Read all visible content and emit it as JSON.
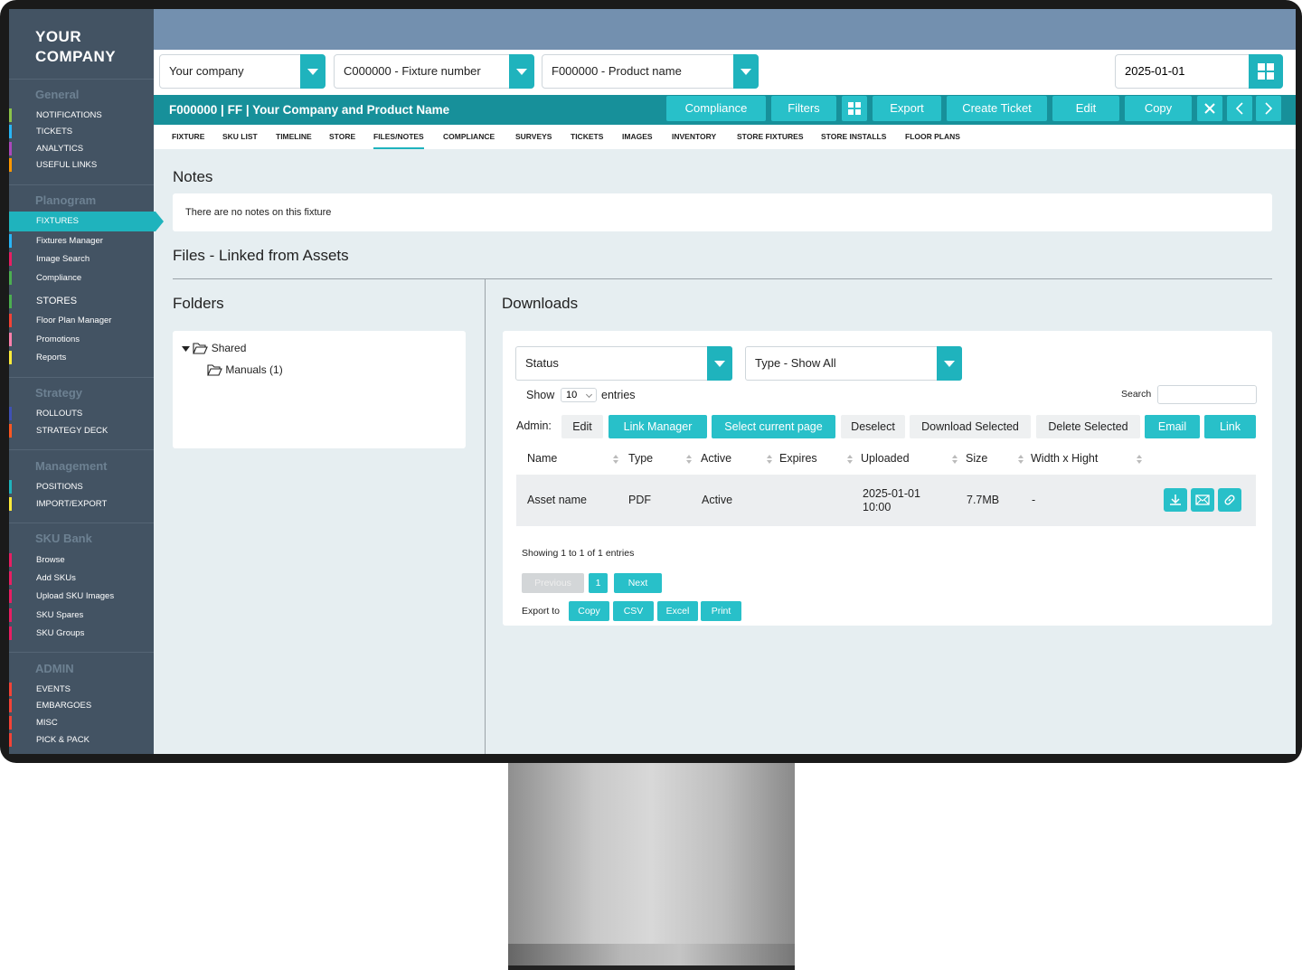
{
  "brand": {
    "line1": "YOUR",
    "line2": "COMPANY"
  },
  "sidebar": {
    "general": {
      "title": "General",
      "items": [
        "NOTIFICATIONS",
        "TICKETS",
        "ANALYTICS",
        "USEFUL LINKS"
      ]
    },
    "planogram": {
      "title": "Planogram",
      "items": [
        "FIXTURES",
        "Fixtures Manager",
        "Image Search",
        "Compliance",
        "STORES",
        "Floor Plan Manager",
        "Promotions",
        "Reports"
      ]
    },
    "strategy": {
      "title": "Strategy",
      "items": [
        "ROLLOUTS",
        "STRATEGY DECK"
      ]
    },
    "management": {
      "title": "Management",
      "items": [
        "POSITIONS",
        "IMPORT/EXPORT"
      ]
    },
    "sku_bank": {
      "title": "SKU Bank",
      "items": [
        "Browse",
        "Add SKUs",
        "Upload SKU Images",
        "SKU Spares",
        "SKU Groups"
      ]
    },
    "admin": {
      "title": "ADMIN",
      "items": [
        "EVENTS",
        "EMBARGOES",
        "MISC",
        "PICK & PACK"
      ]
    },
    "bar_colors": [
      "#8bc34a",
      "#29b6f6",
      "#ab47bc",
      "#ff9800",
      "#e91e63",
      "#f44336",
      "#4caf50",
      "#ffeb3b",
      "#1fb3bd"
    ]
  },
  "selectors": {
    "company": "Your company",
    "fixture": "C000000 - Fixture number",
    "product": "F000000 - Product name",
    "date": "2025-01-01"
  },
  "titlebar": {
    "title": "F000000 | FF | Your Company and Product Name",
    "compliance": "Compliance",
    "filters": "Filters",
    "export": "Export",
    "create_ticket": "Create Ticket",
    "edit": "Edit",
    "copy": "Copy"
  },
  "tabs": [
    "FIXTURE",
    "SKU LIST",
    "TIMELINE",
    "STORE",
    "FILES/NOTES",
    "COMPLIANCE",
    "SURVEYS",
    "TICKETS",
    "IMAGES",
    "INVENTORY",
    "STORE FIXTURES",
    "STORE INSTALLS",
    "FLOOR PLANS"
  ],
  "notes": {
    "heading": "Notes",
    "empty_text": "There are no notes on this fixture"
  },
  "files": {
    "heading": "Files - Linked from Assets"
  },
  "folders": {
    "heading": "Folders",
    "root": "Shared",
    "child": "Manuals (1)"
  },
  "downloads": {
    "heading": "Downloads",
    "status_select": "Status",
    "type_select": "Type - Show All",
    "show_label": "Show",
    "page_length": "10",
    "entries_label": "entries",
    "search_label": "Search",
    "admin_label": "Admin:",
    "admin_buttons": {
      "edit": "Edit",
      "link_manager": "Link Manager",
      "select_page": "Select current page",
      "deselect": "Deselect",
      "download_selected": "Download Selected",
      "delete_selected": "Delete Selected",
      "email": "Email",
      "link": "Link"
    },
    "columns": [
      "Name",
      "Type",
      "Active",
      "Expires",
      "Uploaded",
      "Size",
      "Width x Hight"
    ],
    "rows": [
      {
        "name": "Asset name",
        "type": "PDF",
        "active": "Active",
        "expires": "",
        "uploaded_date": "2025-01-01",
        "uploaded_time": "10:00",
        "size": "7.7MB",
        "dims": "-"
      }
    ],
    "info": "Showing 1 to 1 of 1 entries",
    "pagination": {
      "previous": "Previous",
      "page": "1",
      "next": "Next"
    },
    "export": {
      "label": "Export to",
      "copy": "Copy",
      "csv": "CSV",
      "excel": "Excel",
      "print": "Print"
    }
  }
}
